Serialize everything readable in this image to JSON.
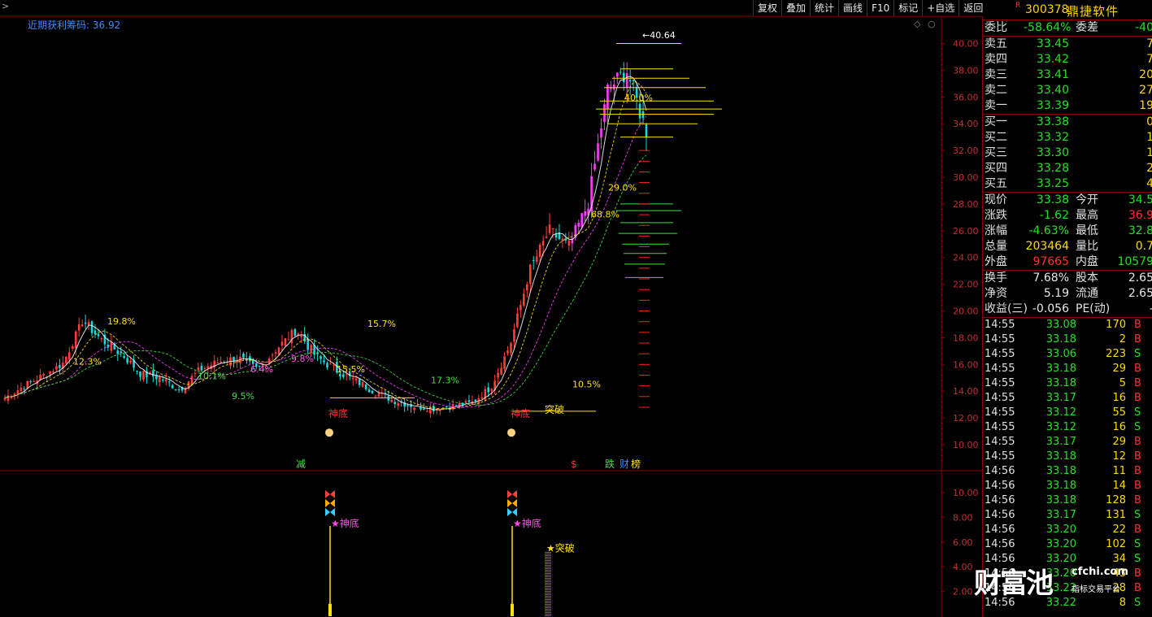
{
  "toolbar": [
    "复权",
    "叠加",
    "统计",
    "画线",
    "F10",
    "标记",
    "+自选",
    "返回"
  ],
  "nav_arrow": ">",
  "indicator": {
    "name": "近期获利筹码:",
    "value": "36.92"
  },
  "icons": {
    "diamond": "◇",
    "circle": "○"
  },
  "stock": {
    "flag": "R",
    "code": "300378",
    "name": "鼎捷软件"
  },
  "weibi": {
    "label1": "委比",
    "value1": "-58.64%",
    "label2": "委差",
    "value2": "-40"
  },
  "sell": [
    {
      "label": "卖五",
      "price": "33.45",
      "vol": "7"
    },
    {
      "label": "卖四",
      "price": "33.42",
      "vol": "7"
    },
    {
      "label": "卖三",
      "price": "33.41",
      "vol": "20"
    },
    {
      "label": "卖二",
      "price": "33.40",
      "vol": "27"
    },
    {
      "label": "卖一",
      "price": "33.39",
      "vol": "19"
    }
  ],
  "buy": [
    {
      "label": "买一",
      "price": "33.38",
      "vol": "0"
    },
    {
      "label": "买二",
      "price": "33.32",
      "vol": "1"
    },
    {
      "label": "买三",
      "price": "33.30",
      "vol": "1"
    },
    {
      "label": "买四",
      "price": "33.28",
      "vol": "2"
    },
    {
      "label": "买五",
      "price": "33.25",
      "vol": "4"
    }
  ],
  "quote": [
    {
      "l1": "现价",
      "v1": "33.38",
      "c1": "g",
      "l2": "今开",
      "v2": "34.5",
      "c2": "g"
    },
    {
      "l1": "涨跌",
      "v1": "-1.62",
      "c1": "g",
      "l2": "最高",
      "v2": "36.9",
      "c2": "rd"
    },
    {
      "l1": "涨幅",
      "v1": "-4.63%",
      "c1": "g",
      "l2": "最低",
      "v2": "32.8",
      "c2": "g"
    },
    {
      "l1": "总量",
      "v1": "203464",
      "c1": "y",
      "l2": "量比",
      "v2": "0.7",
      "c2": "y"
    },
    {
      "l1": "外盘",
      "v1": "97665",
      "c1": "rd",
      "l2": "内盘",
      "v2": "10579",
      "c2": "g"
    }
  ],
  "fund": [
    {
      "l1": "换手",
      "v1": "7.68%",
      "l2": "股本",
      "v2": "2.65"
    },
    {
      "l1": "净资",
      "v1": "5.19",
      "l2": "流通",
      "v2": "2.65"
    },
    {
      "l1": "收益(三)",
      "v1": "-0.056",
      "l2": "PE(动)",
      "v2": "-"
    }
  ],
  "ticks": [
    {
      "t": "14:55",
      "p": "33.08",
      "v": "170",
      "bs": "B"
    },
    {
      "t": "14:55",
      "p": "33.18",
      "v": "2",
      "bs": "B"
    },
    {
      "t": "14:55",
      "p": "33.06",
      "v": "223",
      "bs": "S"
    },
    {
      "t": "14:55",
      "p": "33.18",
      "v": "29",
      "bs": "B"
    },
    {
      "t": "14:55",
      "p": "33.18",
      "v": "5",
      "bs": "B"
    },
    {
      "t": "14:55",
      "p": "33.17",
      "v": "16",
      "bs": "B"
    },
    {
      "t": "14:55",
      "p": "33.12",
      "v": "55",
      "bs": "S"
    },
    {
      "t": "14:55",
      "p": "33.12",
      "v": "16",
      "bs": "S"
    },
    {
      "t": "14:55",
      "p": "33.17",
      "v": "29",
      "bs": "B"
    },
    {
      "t": "14:55",
      "p": "33.18",
      "v": "12",
      "bs": "B"
    },
    {
      "t": "14:56",
      "p": "33.18",
      "v": "11",
      "bs": "B"
    },
    {
      "t": "14:56",
      "p": "33.18",
      "v": "14",
      "bs": "B"
    },
    {
      "t": "14:56",
      "p": "33.18",
      "v": "128",
      "bs": "B"
    },
    {
      "t": "14:56",
      "p": "33.17",
      "v": "131",
      "bs": "S"
    },
    {
      "t": "14:56",
      "p": "33.20",
      "v": "22",
      "bs": "B"
    },
    {
      "t": "14:56",
      "p": "33.20",
      "v": "102",
      "bs": "S"
    },
    {
      "t": "14:56",
      "p": "33.20",
      "v": "34",
      "bs": "S"
    },
    {
      "t": "14:56",
      "p": "33.20",
      "v": "43",
      "bs": "B"
    },
    {
      "t": "14:56",
      "p": "33.22",
      "v": "28",
      "bs": "B"
    },
    {
      "t": "14:56",
      "p": "33.22",
      "v": "8",
      "bs": "S"
    }
  ],
  "watermark": {
    "text": "财富池",
    "domain": "cfchi.com",
    "sub": "指标交易平台"
  },
  "chart_data": {
    "type": "candlestick",
    "y_axis_main": [
      "40.00",
      "38.00",
      "36.00",
      "34.00",
      "32.00",
      "30.00",
      "28.00",
      "26.00",
      "24.00",
      "22.00",
      "20.00",
      "18.00",
      "16.00",
      "14.00",
      "12.00",
      "10.00"
    ],
    "y_axis_sub": [
      "10.00",
      "8.00",
      "6.00",
      "4.00",
      "2.00"
    ],
    "ylim_main": [
      9,
      41.5
    ],
    "ylim_sub": [
      0,
      11
    ],
    "high_label": "40.64",
    "annotations": [
      {
        "text": "19.8%",
        "price": 19.0,
        "color": "#ffe000"
      },
      {
        "text": "12.3%",
        "price": 16.0,
        "color": "#ffe000"
      },
      {
        "text": "10.1%",
        "price": 14.9,
        "color": "#3ee03e"
      },
      {
        "text": "6.4%",
        "price": 15.4,
        "color": "#ff4de8"
      },
      {
        "text": "9.5%",
        "price": 13.4,
        "color": "#3ee03e"
      },
      {
        "text": "9.8%",
        "price": 16.2,
        "color": "#ff4de8"
      },
      {
        "text": "15.5%",
        "price": 15.4,
        "color": "#ffe000"
      },
      {
        "text": "15.7%",
        "price": 18.8,
        "color": "#ffe000"
      },
      {
        "text": "17.3%",
        "price": 14.6,
        "color": "#3ee03e"
      },
      {
        "text": "10.5%",
        "price": 14.3,
        "color": "#ffe000"
      },
      {
        "text": "68.8%",
        "price": 27.0,
        "color": "#ffe000"
      },
      {
        "text": "29.0%",
        "price": 29.0,
        "color": "#ffe000"
      },
      {
        "text": "40.0%",
        "price": 35.7,
        "color": "#ffe000"
      }
    ],
    "signals_main": [
      {
        "text": "神底",
        "price": 12.3,
        "color": "#ff3030"
      },
      {
        "text": "神底",
        "price": 12.3,
        "color": "#ff3030"
      },
      {
        "text": "突破",
        "price": 12.6,
        "color": "#ffe000"
      }
    ],
    "bottom_labels": [
      {
        "text": "减",
        "color": "#3ee03e"
      },
      {
        "text": "$",
        "color": "#ff3030"
      },
      {
        "text": "跌",
        "color": "#3ee03e"
      },
      {
        "text": "财",
        "color": "#3a8cff"
      },
      {
        "text": "榜",
        "color": "#ffe000"
      }
    ],
    "signals_sub": [
      {
        "text": "★神底",
        "value": 7.5,
        "color": "#ff4de8"
      },
      {
        "text": "★神底",
        "value": 7.5,
        "color": "#ff4de8"
      },
      {
        "text": "★突破",
        "value": 5.5,
        "color": "#ffe000"
      }
    ],
    "sub_bars": [
      {
        "value": 7.3
      },
      {
        "value": 7.3
      },
      {
        "value": 5.2
      }
    ],
    "key_closes": [
      13.5,
      14.4,
      15.2,
      16.1,
      19.3,
      17.8,
      16.8,
      15.3,
      15.0,
      14.1,
      15.6,
      16.2,
      16.5,
      15.6,
      17.2,
      18.6,
      16.6,
      15.6,
      14.8,
      14.0,
      13.3,
      12.9,
      12.7,
      12.9,
      13.1,
      14.3,
      17.5,
      23.0,
      26.0,
      24.8,
      28.0,
      36.5,
      38.0,
      33.4
    ]
  }
}
